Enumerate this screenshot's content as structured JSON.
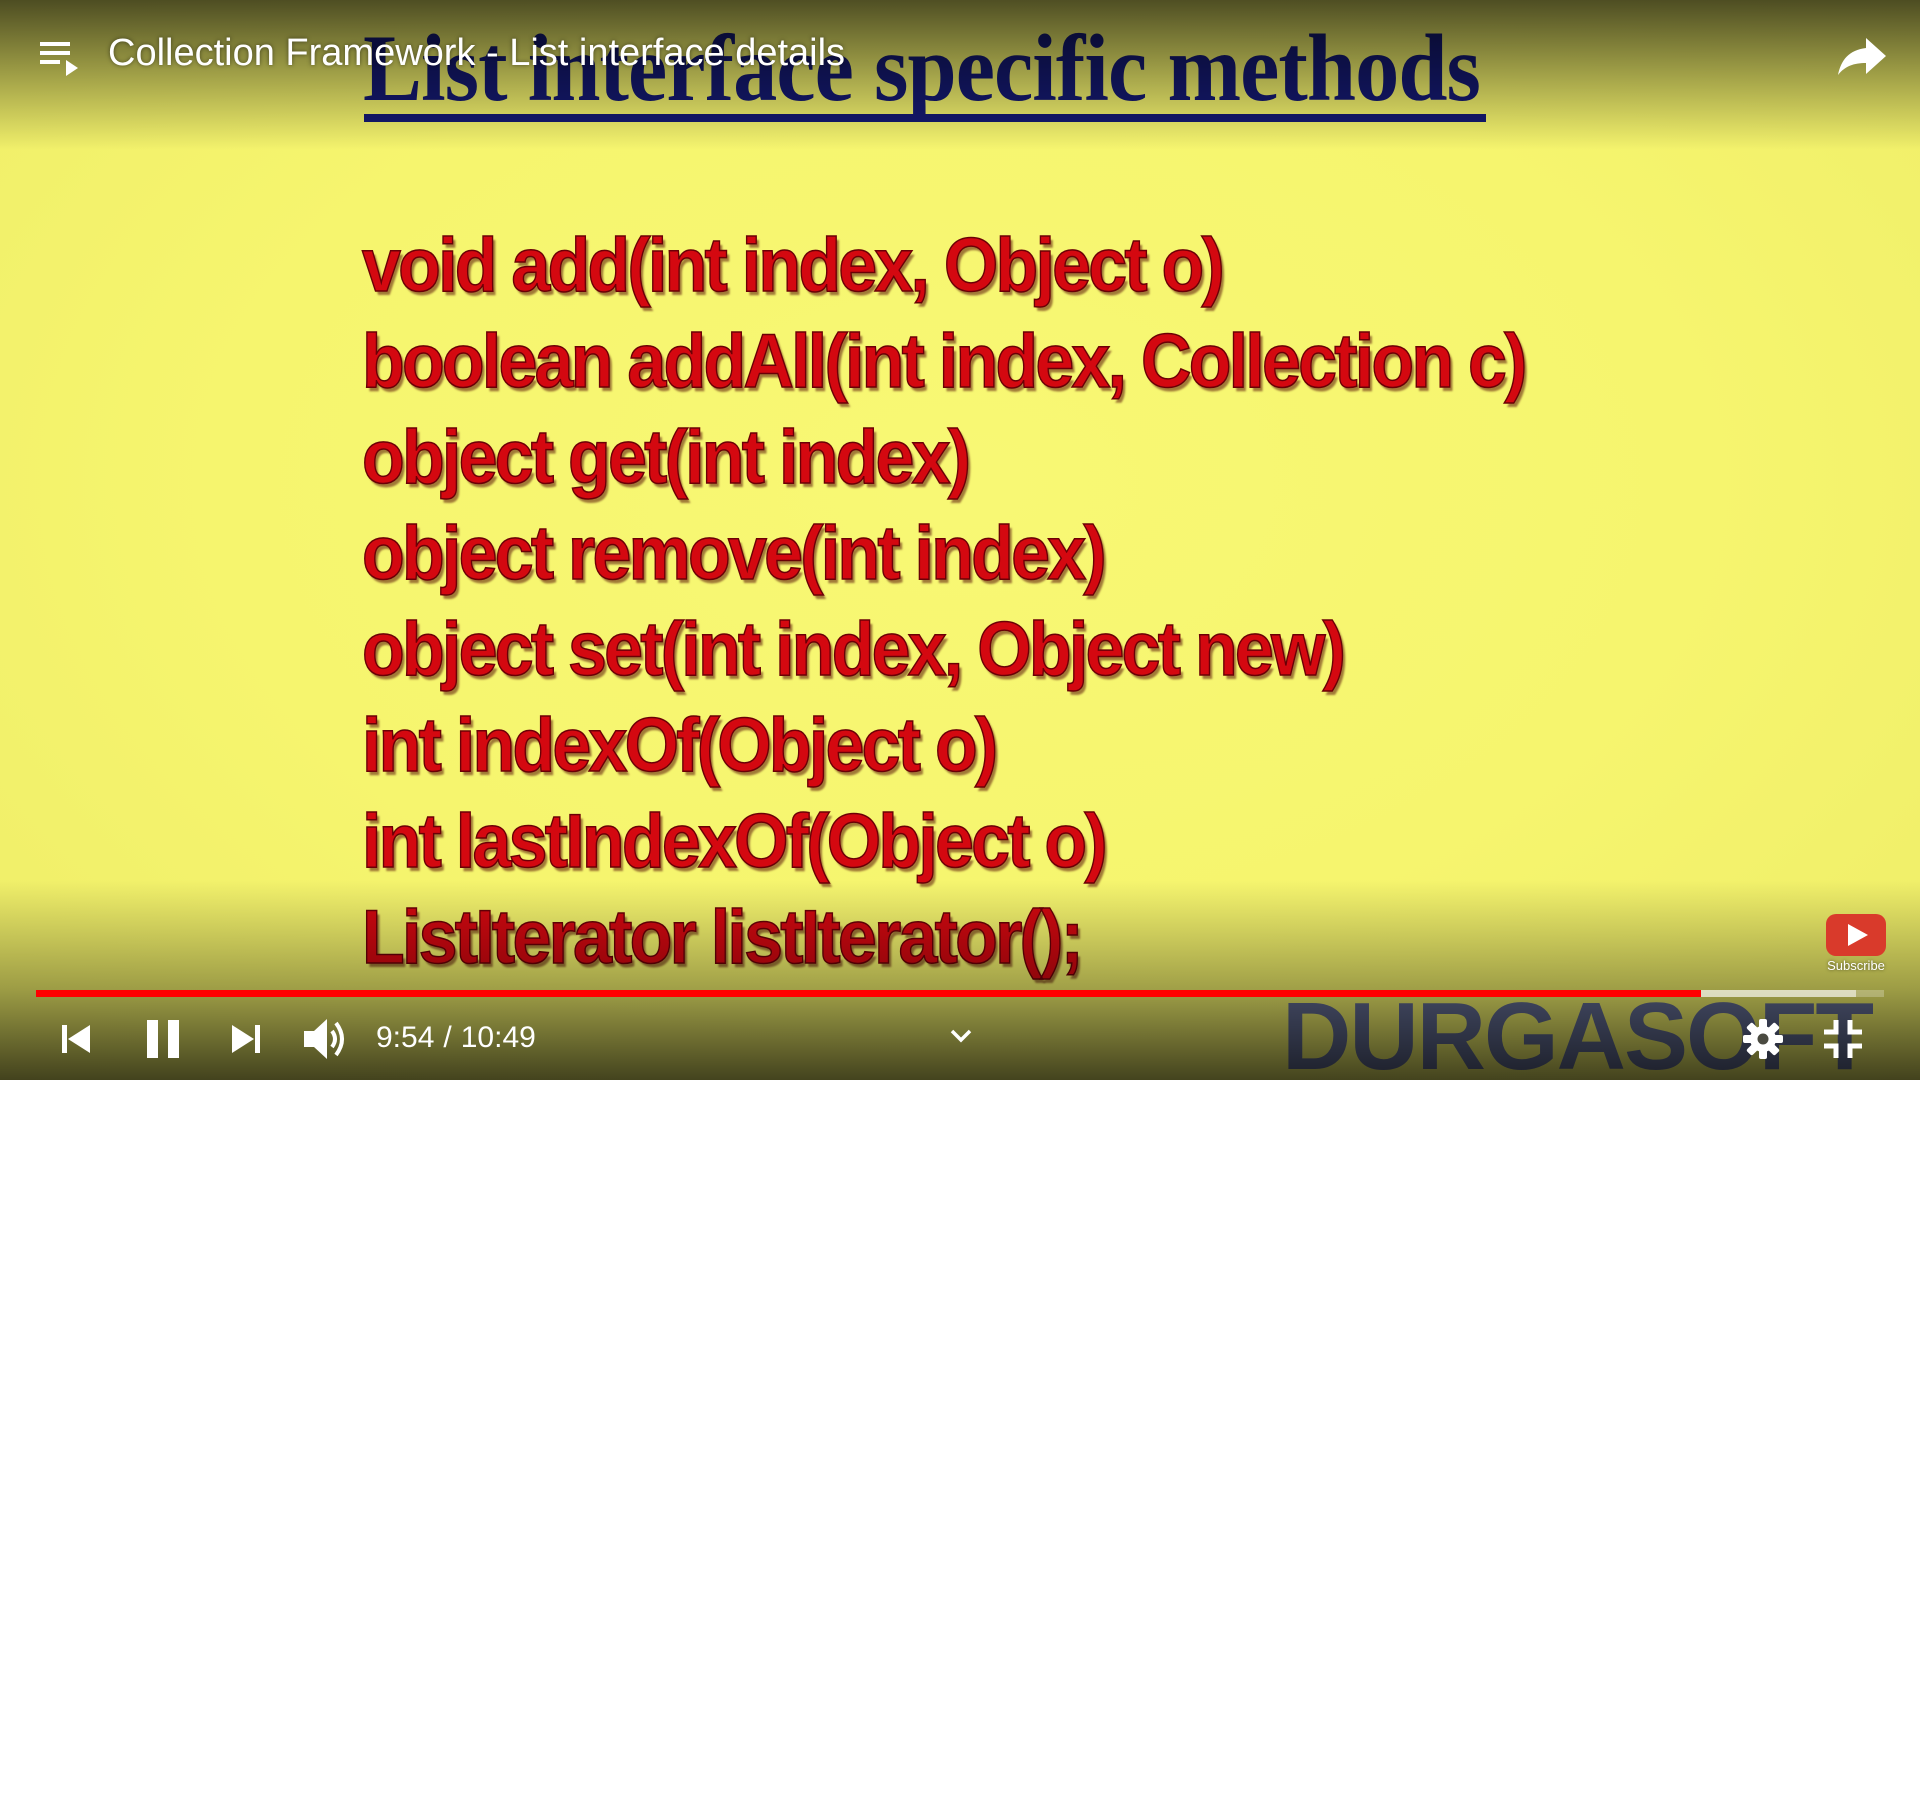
{
  "video": {
    "title": "Collection Framework - List interface details",
    "current_time": "9:54",
    "separator": "/",
    "duration": "10:49",
    "progress_fraction": 0.9009,
    "buffered_fraction": 0.985
  },
  "slide": {
    "heading": "List interface specific methods",
    "methods": [
      "void add(int index, Object o)",
      "boolean addAll(int index, Collection c)",
      "object get(int index)",
      "object remove(int index)",
      "object set(int index, Object new)",
      "int indexOf(Object o)",
      "int lastIndexOf(Object o)",
      "ListIterator listIterator();"
    ],
    "watermark": "DURGASOFT"
  },
  "branding": {
    "subscribe_label": "Subscribe"
  },
  "controls": {
    "icons": [
      "playlist-icon",
      "share-icon",
      "previous-icon",
      "pause-icon",
      "next-icon",
      "volume-icon",
      "chevron-down-icon",
      "gear-icon",
      "exit-fullscreen-icon",
      "subscribe-icon"
    ]
  },
  "colors": {
    "slide_background": "#f6f56f",
    "slide_heading": "#151a73",
    "method_text": "#d40810",
    "progress_played": "#ff0000",
    "watermark": "#3d4aa0"
  }
}
